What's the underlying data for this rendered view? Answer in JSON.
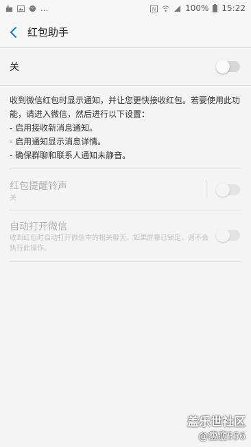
{
  "statusbar": {
    "left_overflow": "...",
    "battery": "100%",
    "time": "15:22"
  },
  "appbar": {
    "title": "红包助手"
  },
  "master": {
    "label": "关",
    "enabled": false
  },
  "description": [
    "收到微信红包时显示通知，并让您更快接收红包。若要使用此功能，请进入微信，然后进行以下设置：",
    "- 启用接收新消息通知。",
    "- 启用通知显示消息详情。",
    "- 确保群聊和联系人通知未静音。"
  ],
  "settings": [
    {
      "title": "红包提醒铃声",
      "subtitle": "关",
      "enabled": false
    },
    {
      "title": "自动打开微信",
      "subtitle": "收到红包时自动打开微信中的相关聊天。如果屏幕已锁定，则不会执行此操作。",
      "enabled": false
    }
  ],
  "watermark": {
    "line1": "盖乐世社区",
    "line2": "@瘦瘦556"
  }
}
